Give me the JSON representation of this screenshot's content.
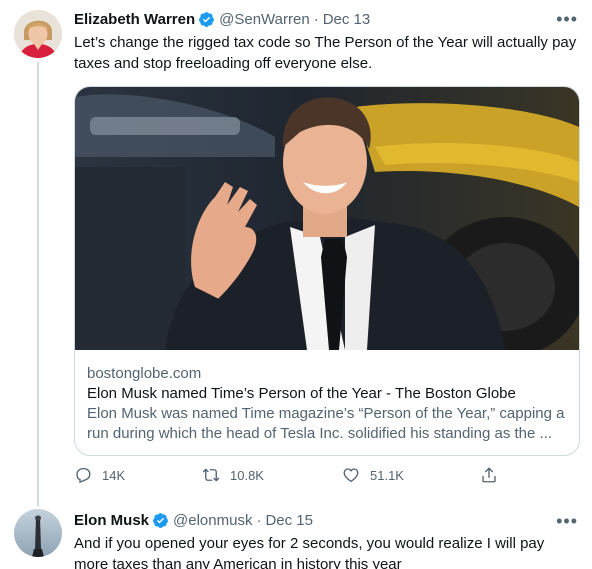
{
  "tweets": [
    {
      "author": {
        "name": "Elizabeth Warren",
        "handle": "@SenWarren",
        "date": "Dec 13",
        "avatar_icon": "avatar-elizabeth-warren",
        "verified_icon": "verified-badge-icon"
      },
      "text": "Let’s change the rigged tax code so The Person of the Year will actually pay taxes and stop freeloading off everyone else.",
      "card": {
        "domain": "bostonglobe.com",
        "title": "Elon Musk named Time’s Person of the Year - The Boston Globe",
        "description": "Elon Musk was named Time magazine’s “Person of the Year,” capping a run during which the head of Tesla Inc. solidified his standing as the ..."
      },
      "actions": {
        "replies": "14K",
        "retweets": "10.8K",
        "likes": "51.1K"
      },
      "more_label": "•••"
    },
    {
      "author": {
        "name": "Elon Musk",
        "handle": "@elonmusk",
        "date": "Dec 15",
        "avatar_icon": "avatar-elon-musk",
        "verified_icon": "verified-badge-icon"
      },
      "text": "And if you opened your eyes for 2 seconds, you would realize I will pay more taxes than any American in history this year",
      "more_label": "•••"
    }
  ],
  "separator": "·",
  "colors": {
    "text_primary": "#0f1419",
    "text_secondary": "#536471",
    "border": "#cfd9de",
    "verified": "#1d9bf0"
  },
  "icons": [
    "reply-icon",
    "retweet-icon",
    "like-icon",
    "share-icon",
    "more-icon",
    "verified-badge-icon"
  ]
}
